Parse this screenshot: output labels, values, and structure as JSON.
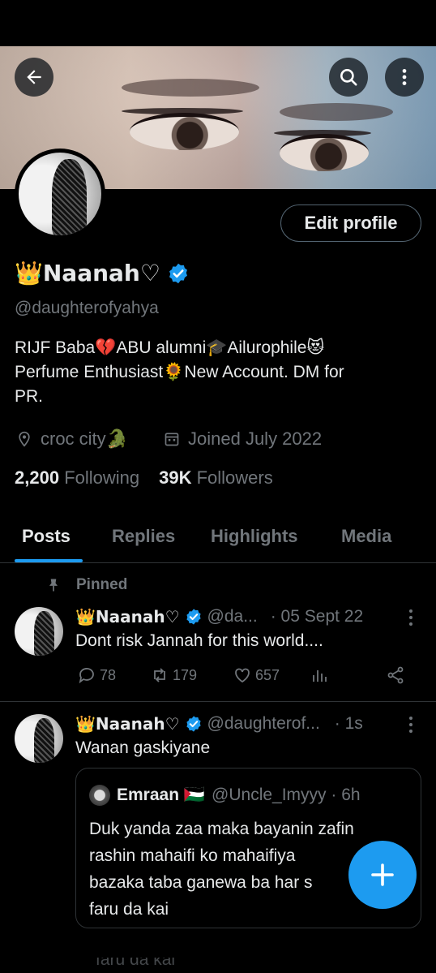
{
  "profile": {
    "name": "👑Naanah♡",
    "handle": "@daughterofyahya",
    "bio_line1": "RIJF Baba💔ABU alumni🎓Ailurophile😻",
    "bio_line2": "Perfume Enthusiast🌻New Account. DM for",
    "bio_line3": "PR.",
    "location": "croc city🐊",
    "joined": "Joined July 2022",
    "following_count": "2,200",
    "following_label": "Following",
    "followers_count": "39K",
    "followers_label": "Followers",
    "edit_label": "Edit profile"
  },
  "tabs": [
    "Posts",
    "Replies",
    "Highlights",
    "Media"
  ],
  "pinned_label": "Pinned",
  "posts": [
    {
      "name": "👑Naanah♡",
      "handle": "@da...",
      "time": "· 05 Sept 22",
      "text": "Dont risk Jannah for this world....",
      "replies": "78",
      "reposts": "179",
      "likes": "657"
    },
    {
      "name": "👑Naanah♡",
      "handle": "@daughterof...",
      "time": "· 1s",
      "text": "Wanan gaskiyane",
      "quote": {
        "name": "Emraan 🇵🇸",
        "handle": "@Uncle_Imyyy · 6h",
        "line1": "Duk yanda zaa maka bayanin zafin",
        "line2": "rashin mahaifi ko mahaifiya",
        "line3": "bazaka taba ganewa ba har s",
        "line4": "faru da kai"
      }
    }
  ],
  "trailing_text": "faru da kai",
  "colors": {
    "accent": "#1d9bf0",
    "background": "#000000",
    "muted": "#71767b",
    "text": "#e7e9ea"
  }
}
